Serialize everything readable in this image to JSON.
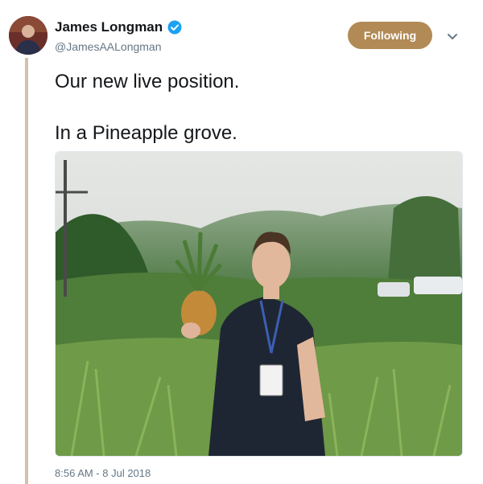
{
  "author": {
    "display_name": "James Longman",
    "handle": "@JamesAALongman",
    "verified": true,
    "avatar_icon": "profile-photo"
  },
  "follow_button": {
    "label": "Following",
    "color": "#b18a55"
  },
  "menu": {
    "icon": "chevron-down-icon"
  },
  "tweet": {
    "lines": [
      "Our new live position.",
      "In a Pineapple grove."
    ],
    "timestamp": "8:56 AM - 8 Jul 2018"
  },
  "colors": {
    "thread_line": "#d3c2ab",
    "text": "#14171a",
    "muted": "#657786"
  }
}
